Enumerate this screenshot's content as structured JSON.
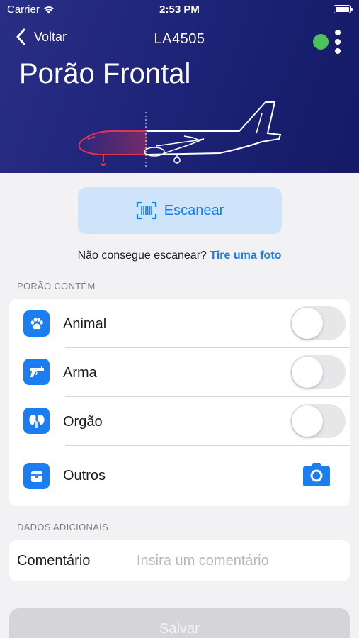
{
  "status_bar": {
    "carrier": "Carrier",
    "time": "2:53 PM"
  },
  "nav": {
    "back_label": "Voltar",
    "flight_number": "LA4505"
  },
  "header": {
    "title": "Porão Frontal"
  },
  "scan": {
    "button_label": "Escanear",
    "alt_text": "Não consegue escanear?",
    "alt_link": "Tire uma foto"
  },
  "hold": {
    "section_label": "PORÃO CONTÉM",
    "items": [
      {
        "label": "Animal",
        "icon": "paw-icon",
        "on": false
      },
      {
        "label": "Arma",
        "icon": "gun-icon",
        "on": false
      },
      {
        "label": "Orgão",
        "icon": "kidney-icon",
        "on": false
      },
      {
        "label": "Outros",
        "icon": "box-icon"
      }
    ]
  },
  "additional": {
    "section_label": "DADOS ADICIONAIS",
    "comment_label": "Comentário",
    "comment_placeholder": "Insira um comentário",
    "comment_value": ""
  },
  "footer": {
    "save_label": "Salvar"
  },
  "colors": {
    "header_start": "#2a2f86",
    "header_end": "#141a66",
    "accent": "#1a7ef0",
    "status_online": "#4cc25a",
    "plane_highlight": "#e0335a"
  }
}
